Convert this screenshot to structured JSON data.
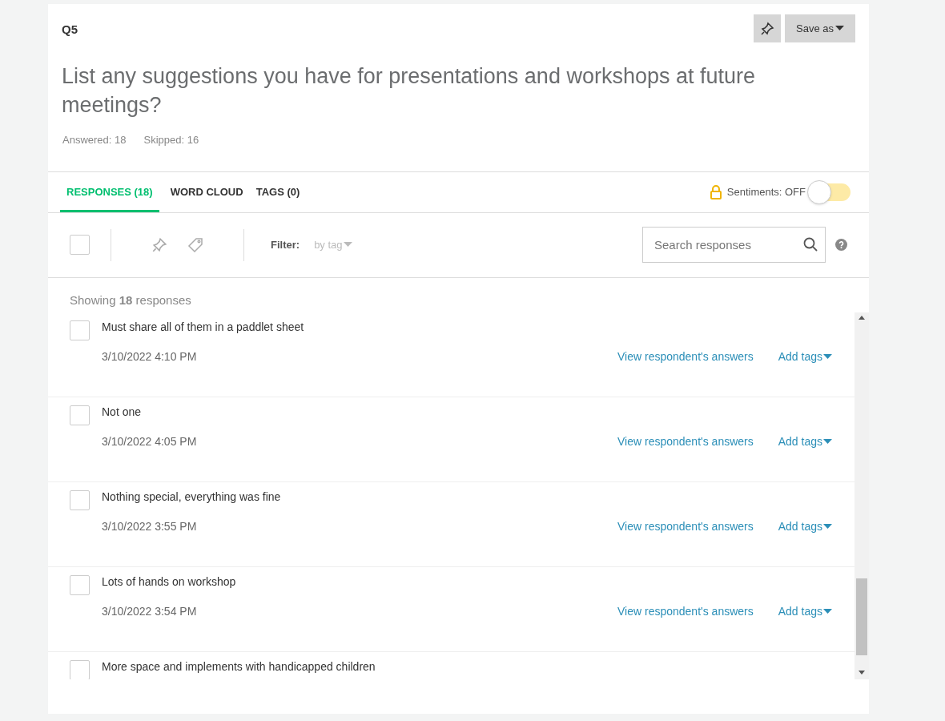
{
  "question": {
    "number": "Q5",
    "text": "List any suggestions you have for presentations and workshops at future meetings?",
    "answered": "Answered: 18",
    "skipped": "Skipped: 16"
  },
  "save_button": "Save as",
  "tabs": [
    {
      "label": "RESPONSES (18)",
      "selected": true
    },
    {
      "label": "WORD CLOUD",
      "selected": false
    },
    {
      "label": "TAGS (0)",
      "selected": false
    }
  ],
  "sentiments": {
    "label": "Sentiments: OFF",
    "on": false
  },
  "toolbar": {
    "select_all_checked": false,
    "filter_label": "Filter:",
    "filter_value": "by tag",
    "search_placeholder": "Search responses"
  },
  "showing": "Showing **18** responses",
  "responses": [
    {
      "text": "Must share all of them in a paddlet sheet",
      "date": "3/10/2022 4:10 PM",
      "view": "View respondent's answers",
      "tags": "Add tags",
      "checked": false
    },
    {
      "text": "Not one",
      "date": "3/10/2022 4:05 PM",
      "view": "View respondent's answers",
      "tags": "Add tags",
      "checked": false
    },
    {
      "text": "Nothing special, everything was fine",
      "date": "3/10/2022 3:55 PM",
      "view": "View respondent's answers",
      "tags": "Add tags",
      "checked": false
    },
    {
      "text": "Lots of hands on workshop",
      "date": "3/10/2022 3:54 PM",
      "view": "View respondent's answers",
      "tags": "Add tags",
      "checked": false
    },
    {
      "text": "More space and implements with handicapped children",
      "checked": false
    }
  ]
}
